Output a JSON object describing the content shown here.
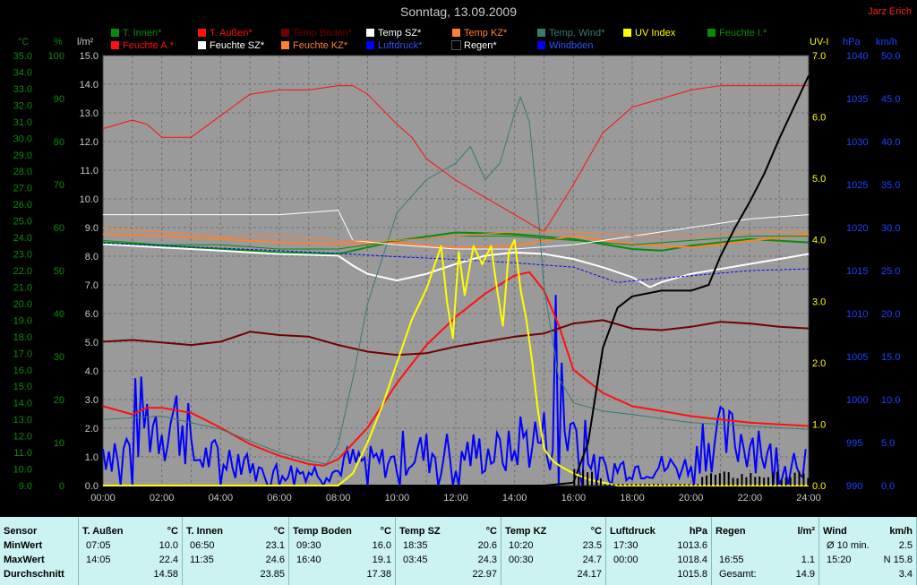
{
  "title": "Sonntag, 13.09.2009",
  "station": "Jarz Erich",
  "legend": [
    {
      "label": "T. Innen*",
      "color": "#0a8a0a"
    },
    {
      "label": "T. Außen*",
      "color": "#ff1010"
    },
    {
      "label": "Temp Boden*",
      "color": "#700000"
    },
    {
      "label": "Temp SZ*",
      "color": "#ffffff"
    },
    {
      "label": "Temp KZ*",
      "color": "#ff8030"
    },
    {
      "label": "Temp. Wind*",
      "color": "#3a7a72"
    },
    {
      "label": "UV Index",
      "color": "#ffff00"
    },
    {
      "label": "Feuchte I.*",
      "color": "#0a8a0a"
    },
    {
      "label": "Feuchte A.*",
      "color": "#ff1010"
    },
    {
      "label": "Feuchte SZ*",
      "color": "#ffffff"
    },
    {
      "label": "Feuchte KZ*",
      "color": "#ff8030"
    },
    {
      "label": "Luftdruck*",
      "color": "#0000ff"
    },
    {
      "label": "Regen*",
      "color": "#000000"
    },
    {
      "label": "Windböen",
      "color": "#0000ff"
    }
  ],
  "axes": {
    "temp_unit": "°C",
    "hum_unit": "%",
    "rain_unit": "l/m²",
    "uv_unit": "UV-I",
    "press_unit": "hPa",
    "wind_unit": "km/h",
    "temp_ticks": [
      "35.0",
      "34.0",
      "33.0",
      "32.0",
      "31.0",
      "30.0",
      "29.0",
      "28.0",
      "27.0",
      "26.0",
      "25.0",
      "24.0",
      "23.0",
      "22.0",
      "21.0",
      "20.0",
      "19.0",
      "18.0",
      "17.0",
      "16.0",
      "15.0",
      "14.0",
      "13.0",
      "12.0",
      "11.0",
      "10.0",
      "9.0"
    ],
    "hum_ticks": [
      "100",
      "90",
      "80",
      "70",
      "60",
      "50",
      "40",
      "30",
      "20",
      "10",
      "0"
    ],
    "rain_ticks": [
      "15.0",
      "14.0",
      "13.0",
      "12.0",
      "11.0",
      "10.0",
      "9.0",
      "8.0",
      "7.0",
      "6.0",
      "5.0",
      "4.0",
      "3.0",
      "2.0",
      "1.0",
      "0.0"
    ],
    "uv_ticks": [
      "7.0",
      "6.0",
      "5.0",
      "4.0",
      "3.0",
      "2.0",
      "1.0",
      "0.0"
    ],
    "press_ticks": [
      "1040",
      "1035",
      "1030",
      "1025",
      "1020",
      "1015",
      "1010",
      "1005",
      "1000",
      "995",
      "990"
    ],
    "wind_ticks": [
      "50.0",
      "45.0",
      "40.0",
      "35.0",
      "30.0",
      "25.0",
      "20.0",
      "15.0",
      "10.0",
      "5.0",
      "0.0"
    ],
    "time_ticks": [
      "00:00",
      "02:00",
      "04:00",
      "06:00",
      "08:00",
      "10:00",
      "12:00",
      "14:00",
      "16:00",
      "18:00",
      "20:00",
      "22:00",
      "24:00"
    ]
  },
  "chart_data": {
    "type": "line",
    "title": "Sonntag, 13.09.2009",
    "x_unit": "hours",
    "xlim": [
      0,
      24
    ],
    "axes_ranges": {
      "temp": [
        9,
        35
      ],
      "hum": [
        0,
        100
      ],
      "rain": [
        0,
        15
      ],
      "uv": [
        0,
        7
      ],
      "press": [
        990,
        1040
      ],
      "wind": [
        0,
        50
      ]
    },
    "grid": true,
    "legend_position": "top",
    "series": [
      {
        "name": "T. Außen*",
        "axis": "temp",
        "color": "#ff1010",
        "width": 2,
        "x": [
          0,
          1,
          1.5,
          2,
          3,
          4,
          5,
          6,
          7,
          7.5,
          8,
          9,
          10,
          11,
          12,
          13,
          14,
          14.5,
          15,
          15.5,
          16,
          17,
          18,
          19,
          20,
          21,
          22,
          23,
          24
        ],
        "y": [
          13.8,
          13.3,
          13.7,
          13.7,
          13.4,
          12.5,
          11.5,
          10.8,
          10.3,
          10.2,
          10.6,
          12.5,
          15.2,
          17.5,
          19.2,
          20.6,
          21.7,
          21.9,
          20.8,
          18.7,
          16.0,
          14.6,
          13.8,
          13.5,
          13.2,
          13.0,
          12.8,
          12.7,
          12.6
        ]
      },
      {
        "name": "T. Innen*",
        "axis": "temp",
        "color": "#0a8a0a",
        "width": 2,
        "x": [
          0,
          2,
          4,
          6,
          8,
          10,
          12,
          14,
          16,
          18,
          19,
          20,
          22,
          24
        ],
        "y": [
          23.7,
          23.5,
          23.3,
          23.1,
          23.0,
          23.8,
          24.3,
          24.2,
          23.9,
          23.3,
          23.2,
          23.5,
          23.9,
          23.7
        ]
      },
      {
        "name": "Temp Boden*",
        "axis": "temp",
        "color": "#700000",
        "width": 2,
        "x": [
          0,
          1,
          3,
          4,
          5,
          6,
          7,
          8,
          9,
          10,
          11,
          12,
          13,
          14,
          15,
          15.5,
          16,
          17,
          18,
          19,
          20,
          21,
          22,
          23,
          24
        ],
        "y": [
          17.7,
          17.8,
          17.5,
          17.7,
          18.3,
          18.1,
          18.0,
          17.5,
          17.1,
          16.9,
          17.0,
          17.4,
          17.7,
          18.0,
          18.2,
          18.5,
          18.8,
          19.0,
          18.5,
          18.4,
          18.6,
          18.9,
          18.8,
          18.6,
          18.5
        ]
      },
      {
        "name": "Temp SZ*",
        "axis": "temp",
        "color": "#ffffff",
        "width": 2,
        "x": [
          0,
          2,
          4,
          6,
          8,
          8.5,
          9,
          10,
          11,
          12,
          13,
          14,
          15,
          16,
          17,
          18,
          18.6,
          19,
          20,
          21,
          22,
          23,
          24
        ],
        "y": [
          23.6,
          23.4,
          23.2,
          23.0,
          22.9,
          22.3,
          21.8,
          21.4,
          21.8,
          22.4,
          22.9,
          23.1,
          23.0,
          22.7,
          22.2,
          21.6,
          21.0,
          21.3,
          21.8,
          22.1,
          22.4,
          22.7,
          23.0
        ]
      },
      {
        "name": "Temp KZ*",
        "axis": "temp",
        "color": "#ff8030",
        "width": 2,
        "x": [
          0,
          2,
          4,
          6,
          8,
          10,
          11,
          12,
          14,
          16,
          18,
          20,
          22,
          24
        ],
        "y": [
          24.2,
          24.1,
          23.9,
          23.7,
          23.6,
          23.7,
          23.5,
          23.4,
          23.5,
          24.1,
          23.6,
          23.4,
          23.8,
          24.2
        ]
      },
      {
        "name": "Temp. Wind*",
        "axis": "temp",
        "color": "#3a7a72",
        "width": 1,
        "x": [
          0,
          2,
          4,
          6,
          7,
          7.6,
          8,
          8.5,
          9,
          10,
          11,
          12,
          12.5,
          13,
          13.5,
          14,
          14.2,
          14.5,
          14.8,
          15,
          15.5,
          16,
          17,
          18,
          20,
          22,
          24
        ],
        "y": [
          13.0,
          13.2,
          12.4,
          11.0,
          10.5,
          10.3,
          11.5,
          15.5,
          20.0,
          25.5,
          27.5,
          28.5,
          29.5,
          27.5,
          28.5,
          31.5,
          32.5,
          31.0,
          25.5,
          21.0,
          15.5,
          14.0,
          13.5,
          13.3,
          12.8,
          12.6,
          12.4
        ]
      },
      {
        "name": "Feuchte A.*",
        "axis": "hum",
        "color": "#ff1010",
        "width": 1,
        "x": [
          0,
          1,
          1.5,
          2,
          3,
          4,
          5,
          6,
          7,
          8,
          8.5,
          9,
          10,
          10.5,
          11,
          12,
          13,
          14,
          14.5,
          15,
          16,
          17,
          18,
          19,
          20,
          21,
          22,
          23,
          24
        ],
        "y": [
          83,
          85,
          84,
          81,
          81,
          86,
          91,
          92,
          92,
          93,
          93,
          91,
          84,
          81,
          76,
          71,
          67,
          63,
          61,
          59,
          70,
          82,
          88,
          90,
          92,
          93,
          93,
          93,
          93
        ]
      },
      {
        "name": "Feuchte I.*",
        "axis": "hum",
        "color": "#0a8a0a",
        "width": 1,
        "x": [
          0,
          2,
          4,
          6,
          8,
          10,
          12,
          14,
          16,
          18,
          20,
          22,
          24
        ],
        "y": [
          57,
          56,
          56,
          55,
          55,
          57,
          58,
          58,
          57,
          56,
          57,
          58,
          58
        ]
      },
      {
        "name": "Feuchte SZ*",
        "axis": "hum",
        "color": "#ffffff",
        "width": 1,
        "x": [
          0,
          2,
          4,
          6,
          8,
          8.5,
          10,
          12,
          14,
          16,
          18,
          20,
          22,
          24
        ],
        "y": [
          63,
          63,
          63,
          63,
          64,
          57,
          56,
          55,
          55,
          56,
          58,
          60,
          62,
          63
        ]
      },
      {
        "name": "Feuchte KZ*",
        "axis": "hum",
        "color": "#ff8030",
        "width": 1,
        "x": [
          0,
          2,
          4,
          6,
          8,
          10,
          12,
          14,
          16,
          18,
          20,
          22,
          24
        ],
        "y": [
          60,
          59,
          58,
          58,
          57,
          57,
          58,
          59,
          59,
          58,
          58,
          59,
          59
        ]
      },
      {
        "name": "Luftdruck*",
        "axis": "press",
        "color": "#0000ff",
        "width": 1,
        "dashed": true,
        "x": [
          0,
          2,
          4,
          6,
          8,
          10,
          12,
          14,
          16,
          17.5,
          18,
          20,
          22,
          24
        ],
        "y": [
          1018.2,
          1017.9,
          1017.6,
          1017.3,
          1017.0,
          1016.6,
          1016.3,
          1015.9,
          1015.4,
          1013.6,
          1013.8,
          1014.4,
          1015.0,
          1015.2
        ]
      },
      {
        "name": "Regen*",
        "axis": "rain",
        "color": "#000000",
        "width": 2,
        "x": [
          0,
          8,
          15,
          16,
          16.5,
          17,
          17.5,
          18,
          19,
          20,
          20.6,
          21,
          21.5,
          22,
          22.5,
          23,
          23.5,
          24
        ],
        "y": [
          0,
          0,
          0,
          0.1,
          1.5,
          4.8,
          6.2,
          6.6,
          6.8,
          6.8,
          7.0,
          8.0,
          9.0,
          9.9,
          10.9,
          12.1,
          13.2,
          14.3
        ]
      },
      {
        "name": "UV Index",
        "axis": "uv",
        "color": "#ffff00",
        "width": 2,
        "x": [
          0,
          8,
          8.5,
          9,
          9.5,
          10,
          10.5,
          11,
          11.5,
          11.7,
          11.9,
          12.1,
          12.3,
          12.6,
          12.9,
          13.2,
          13.4,
          13.6,
          13.8,
          14,
          14.2,
          14.4,
          14.6,
          14.8,
          15,
          15.3,
          15.6,
          16,
          16.5,
          17,
          17.5,
          18,
          24
        ],
        "y": [
          0,
          0,
          0.2,
          0.7,
          1.3,
          2.0,
          2.7,
          3.2,
          3.9,
          3.0,
          2.4,
          3.8,
          3.1,
          3.9,
          3.6,
          3.9,
          3.2,
          2.6,
          3.8,
          4.0,
          3.2,
          2.7,
          2.0,
          1.2,
          0.6,
          0.4,
          0.3,
          0.2,
          0.1,
          0.05,
          0,
          0,
          0
        ]
      }
    ]
  },
  "stats": {
    "columns": [
      {
        "header": "Sensor",
        "rows": [
          "MinWert",
          "MaxWert",
          "Durchschnitt"
        ]
      },
      {
        "header": "T. Außen",
        "unit": "°C",
        "rows": [
          [
            "07:05",
            "10.0"
          ],
          [
            "14:05",
            "22.4"
          ],
          [
            "",
            "14.58"
          ]
        ]
      },
      {
        "header": "T. Innen",
        "unit": "°C",
        "rows": [
          [
            "06:50",
            "23.1"
          ],
          [
            "11:35",
            "24.6"
          ],
          [
            "",
            "23.85"
          ]
        ]
      },
      {
        "header": "Temp Boden",
        "unit": "°C",
        "rows": [
          [
            "09:30",
            "16.0"
          ],
          [
            "16:40",
            "19.1"
          ],
          [
            "",
            "17.38"
          ]
        ]
      },
      {
        "header": "Temp SZ",
        "unit": "°C",
        "rows": [
          [
            "18:35",
            "20.6"
          ],
          [
            "03:45",
            "24.3"
          ],
          [
            "",
            "22.97"
          ]
        ]
      },
      {
        "header": "Temp KZ",
        "unit": "°C",
        "rows": [
          [
            "10:20",
            "23.5"
          ],
          [
            "00:30",
            "24.7"
          ],
          [
            "",
            "24.17"
          ]
        ]
      },
      {
        "header": "Luftdruck",
        "unit": "hPa",
        "rows": [
          [
            "17:30",
            "1013.6"
          ],
          [
            "00:00",
            "1018.4"
          ],
          [
            "",
            "1015.8"
          ]
        ]
      },
      {
        "header": "Regen",
        "unit": "l/m²",
        "rows": [
          [
            "",
            ""
          ],
          [
            "16:55",
            "1.1"
          ],
          [
            "Gesamt:",
            "14.9"
          ]
        ]
      },
      {
        "header": "Wind",
        "unit": "km/h",
        "rows": [
          [
            "Ø 10 min.",
            "2.5"
          ],
          [
            "15:20",
            "N 15.8"
          ],
          [
            "",
            "3.4"
          ]
        ]
      }
    ]
  }
}
